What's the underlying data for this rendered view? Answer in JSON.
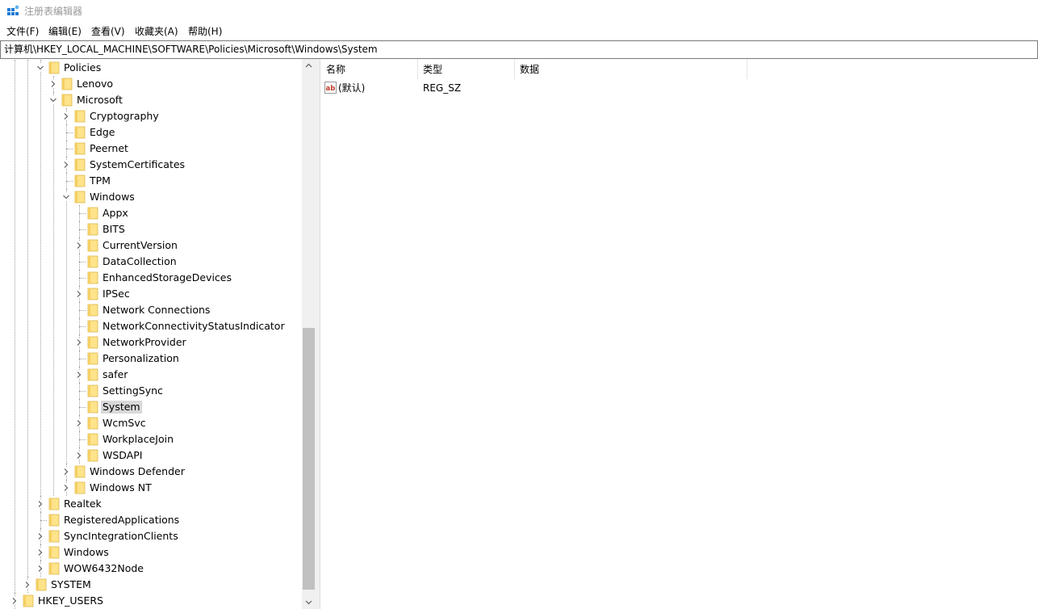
{
  "window": {
    "title": "注册表编辑器"
  },
  "menu": [
    "文件(F)",
    "编辑(E)",
    "查看(V)",
    "收藏夹(A)",
    "帮助(H)"
  ],
  "address": "计算机\\HKEY_LOCAL_MACHINE\\SOFTWARE\\Policies\\Microsoft\\Windows\\System",
  "tree": [
    {
      "label": "Policies",
      "depth": 2,
      "exp": "open"
    },
    {
      "label": "Lenovo",
      "depth": 3,
      "exp": "closed"
    },
    {
      "label": "Microsoft",
      "depth": 3,
      "exp": "open"
    },
    {
      "label": "Cryptography",
      "depth": 4,
      "exp": "closed"
    },
    {
      "label": "Edge",
      "depth": 4,
      "exp": "none"
    },
    {
      "label": "Peernet",
      "depth": 4,
      "exp": "none"
    },
    {
      "label": "SystemCertificates",
      "depth": 4,
      "exp": "closed"
    },
    {
      "label": "TPM",
      "depth": 4,
      "exp": "none"
    },
    {
      "label": "Windows",
      "depth": 4,
      "exp": "open"
    },
    {
      "label": "Appx",
      "depth": 5,
      "exp": "none"
    },
    {
      "label": "BITS",
      "depth": 5,
      "exp": "none"
    },
    {
      "label": "CurrentVersion",
      "depth": 5,
      "exp": "closed"
    },
    {
      "label": "DataCollection",
      "depth": 5,
      "exp": "none"
    },
    {
      "label": "EnhancedStorageDevices",
      "depth": 5,
      "exp": "none"
    },
    {
      "label": "IPSec",
      "depth": 5,
      "exp": "closed"
    },
    {
      "label": "Network Connections",
      "depth": 5,
      "exp": "none"
    },
    {
      "label": "NetworkConnectivityStatusIndicator",
      "depth": 5,
      "exp": "none"
    },
    {
      "label": "NetworkProvider",
      "depth": 5,
      "exp": "closed"
    },
    {
      "label": "Personalization",
      "depth": 5,
      "exp": "none"
    },
    {
      "label": "safer",
      "depth": 5,
      "exp": "closed"
    },
    {
      "label": "SettingSync",
      "depth": 5,
      "exp": "none"
    },
    {
      "label": "System",
      "depth": 5,
      "exp": "none",
      "selected": true
    },
    {
      "label": "WcmSvc",
      "depth": 5,
      "exp": "closed"
    },
    {
      "label": "WorkplaceJoin",
      "depth": 5,
      "exp": "none"
    },
    {
      "label": "WSDAPI",
      "depth": 5,
      "exp": "closed"
    },
    {
      "label": "Windows Defender",
      "depth": 4,
      "exp": "closed"
    },
    {
      "label": "Windows NT",
      "depth": 4,
      "exp": "closed"
    },
    {
      "label": "Realtek",
      "depth": 2,
      "exp": "closed"
    },
    {
      "label": "RegisteredApplications",
      "depth": 2,
      "exp": "none"
    },
    {
      "label": "SyncIntegrationClients",
      "depth": 2,
      "exp": "closed"
    },
    {
      "label": "Windows",
      "depth": 2,
      "exp": "closed"
    },
    {
      "label": "WOW6432Node",
      "depth": 2,
      "exp": "closed"
    },
    {
      "label": "SYSTEM",
      "depth": 1,
      "exp": "closed"
    },
    {
      "label": "HKEY_USERS",
      "depth": 0,
      "exp": "closed"
    }
  ],
  "list": {
    "columns": [
      "名称",
      "类型",
      "数据"
    ],
    "rows": [
      {
        "name": "(默认)",
        "type": "REG_SZ",
        "data": "",
        "icon": "string-value-icon"
      }
    ]
  }
}
